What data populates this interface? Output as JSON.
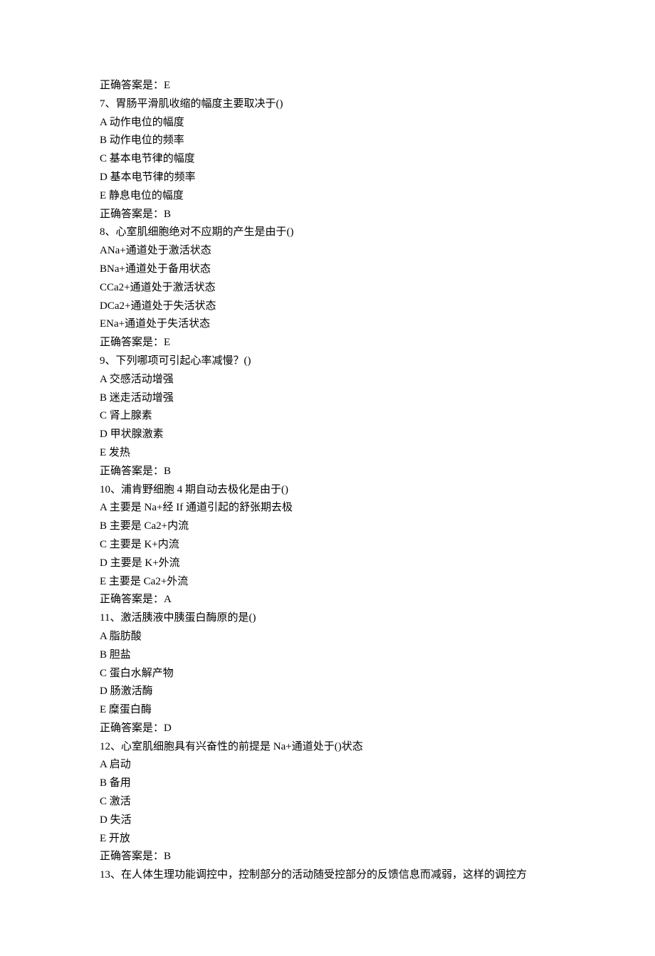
{
  "lines": [
    "正确答案是：E",
    "7、胃肠平滑肌收缩的幅度主要取决于()",
    "A 动作电位的幅度",
    "B 动作电位的频率",
    "C 基本电节律的幅度",
    "D 基本电节律的频率",
    "E 静息电位的幅度",
    "正确答案是：B",
    "8、心室肌细胞绝对不应期的产生是由于()",
    "ANa+通道处于激活状态",
    "BNa+通道处于备用状态",
    "CCa2+通道处于激活状态",
    "DCa2+通道处于失活状态",
    "ENa+通道处于失活状态",
    "正确答案是：E",
    "9、下列哪项可引起心率减慢？()",
    "A 交感活动增强",
    "B 迷走活动增强",
    "C 肾上腺素",
    "D 甲状腺激素",
    "E 发热",
    "正确答案是：B",
    "10、浦肯野细胞 4 期自动去极化是由于()",
    "A 主要是 Na+经 If 通道引起的舒张期去极",
    "B 主要是 Ca2+内流",
    "C 主要是 K+内流",
    "D 主要是 K+外流",
    "E 主要是 Ca2+外流",
    "正确答案是：A",
    "11、激活胰液中胰蛋白酶原的是()",
    "A 脂肪酸",
    "B 胆盐",
    "C 蛋白水解产物",
    "D 肠激活酶",
    "E 糜蛋白酶",
    "正确答案是：D",
    "12、心室肌细胞具有兴奋性的前提是 Na+通道处于()状态",
    "A 启动",
    "B 备用",
    "C 激活",
    "D 失活",
    "E 开放",
    "正确答案是：B",
    "13、在人体生理功能调控中，控制部分的活动随受控部分的反馈信息而减弱，这样的调控方"
  ]
}
